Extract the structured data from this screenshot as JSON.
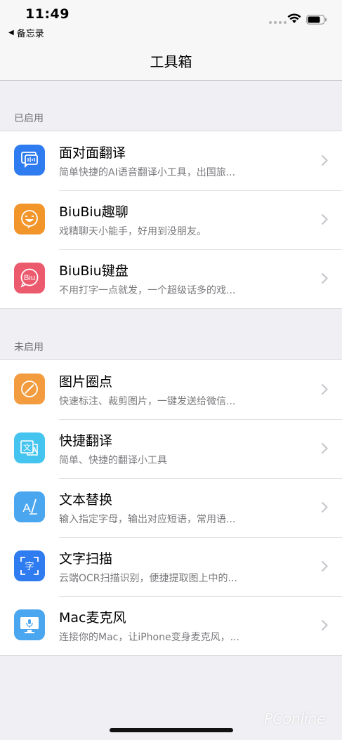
{
  "status_bar": {
    "time": "11:49",
    "back_label": "备忘录",
    "back_icon": "back-triangle-icon"
  },
  "nav": {
    "title": "工具箱"
  },
  "sections": {
    "enabled": {
      "header": "已启用",
      "items": [
        {
          "title": "面对面翻译",
          "subtitle": "简单快捷的AI语音翻译小工具，出国旅...",
          "icon": "chat-translate-icon",
          "color": "#2f7bf0"
        },
        {
          "title": "BiuBiu趣聊",
          "subtitle": "戏精聊天小能手，好用到没朋友。",
          "icon": "smiley-icon",
          "color": "#f2952a"
        },
        {
          "title": "BiuBiu键盘",
          "subtitle": "不用打字一点就发，一个超级话多的戏...",
          "icon": "biu-bubble-icon",
          "color": "#ec5a6e"
        }
      ]
    },
    "disabled": {
      "header": "未启用",
      "items": [
        {
          "title": "图片圈点",
          "subtitle": "快速标注、裁剪图片，一键发送给微信...",
          "icon": "brush-circle-icon",
          "color": "#f29c3f"
        },
        {
          "title": "快捷翻译",
          "subtitle": "简单、快捷的翻译小工具",
          "icon": "translate-icon",
          "color": "#44c4ee"
        },
        {
          "title": "文本替换",
          "subtitle": "输入指定字母，输出对应短语，常用语...",
          "icon": "text-replace-icon",
          "color": "#4aa6ef"
        },
        {
          "title": "文字扫描",
          "subtitle": "云端OCR扫描识别，便捷提取图上中的...",
          "icon": "text-scan-icon",
          "color": "#2f7bf0"
        },
        {
          "title": "Mac麦克风",
          "subtitle": "连接你的Mac，让iPhone变身麦克风，...",
          "icon": "mac-mic-icon",
          "color": "#4aa6ef"
        }
      ]
    }
  },
  "watermark": "PConline",
  "icon_glyphs": {
    "biu_text": "Biu",
    "translate_text": "文",
    "text_replace_text": "A",
    "scan_text": "字"
  }
}
